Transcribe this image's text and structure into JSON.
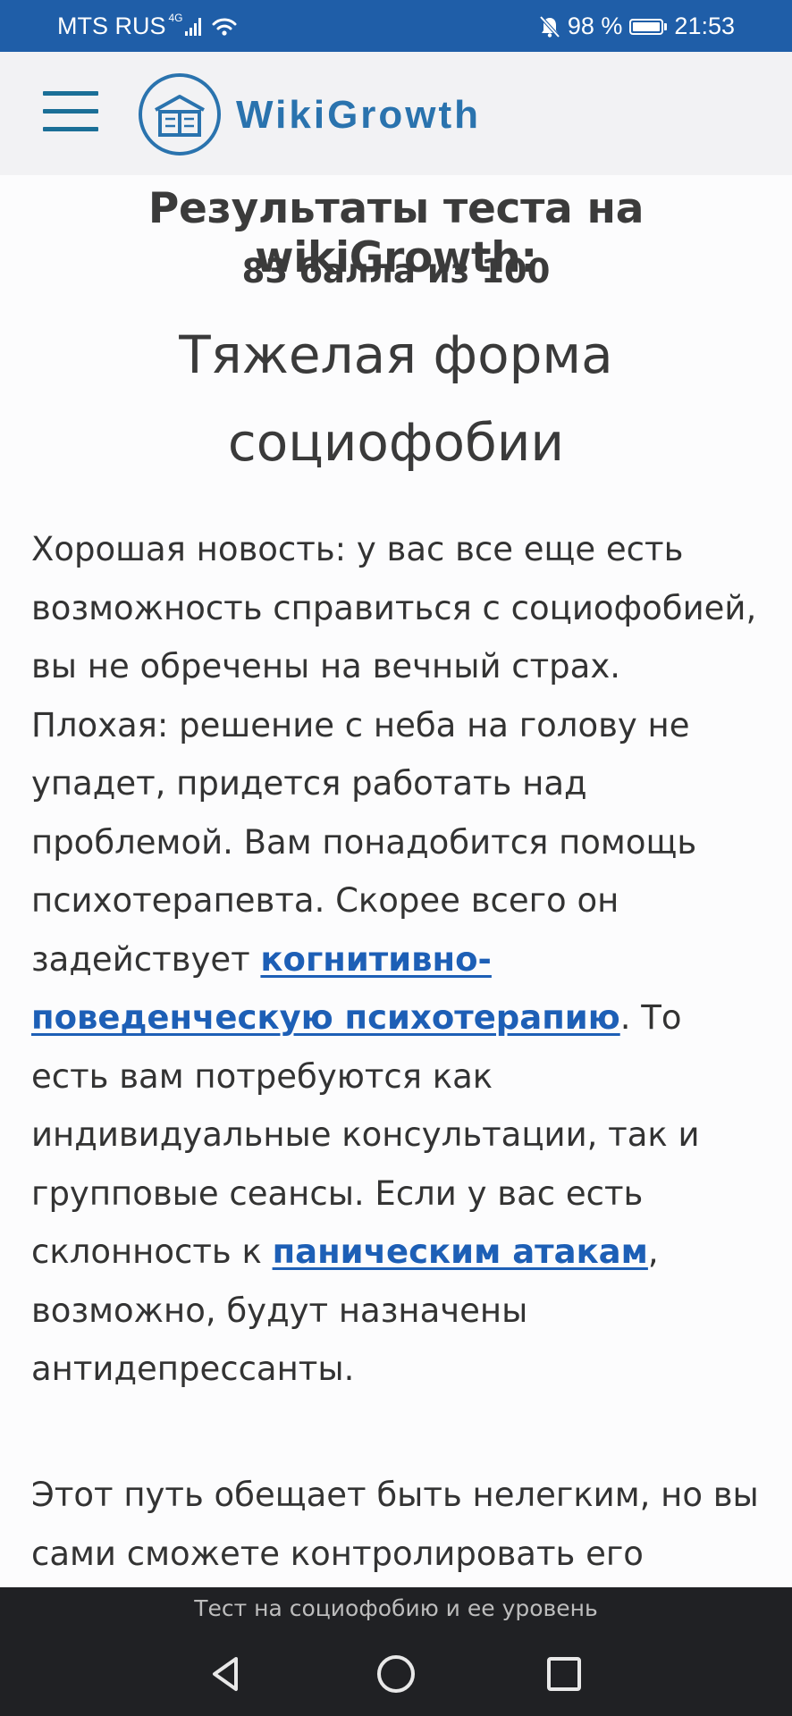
{
  "status_bar": {
    "carrier": "MTS RUS",
    "network": "4G",
    "battery_percent": "98 %",
    "battery_level": 0.98,
    "time": "21:53"
  },
  "header": {
    "logo_text": "WikiGrowth",
    "menu_icon": "hamburger-icon",
    "logo_icon": "book-icon"
  },
  "article": {
    "heading": "Результаты теста на wikiGrowth:",
    "score": "83 балла из 100",
    "result_line1": "Тяжелая форма",
    "result_line2": "социофобии",
    "paragraph1": {
      "text_before_link1": "Хорошая новость: у вас все еще есть возможность справиться с социофобией, вы не обречены на вечный страх. Плохая: решение с неба на голову не упадет, придется работать над проблемой. Вам понадобится помощь психотерапевта. Скорее всего он задействует ",
      "link1": "когнитивно-поведенческую психотерапию",
      "text_between": ". То есть вам потребуются как индивидуальные консультации, так и групповые сеансы. Если у вас есть склонность к ",
      "link2": "паническим атакам",
      "text_after": ", возможно, будут назначены антидепрессанты."
    },
    "paragraph2": "Этот путь обещает быть нелегким, но вы сами сможете контролировать его"
  },
  "bottom_caption": "Тест на социофобию и ее уровень",
  "colors": {
    "status_bar": "#1f5ea8",
    "link": "#1d5fb6",
    "logo": "#2a73ae",
    "nav_bar": "#202124"
  },
  "nav": {
    "back_icon": "back-triangle-icon",
    "home_icon": "home-circle-icon",
    "recents_icon": "recents-square-icon"
  }
}
